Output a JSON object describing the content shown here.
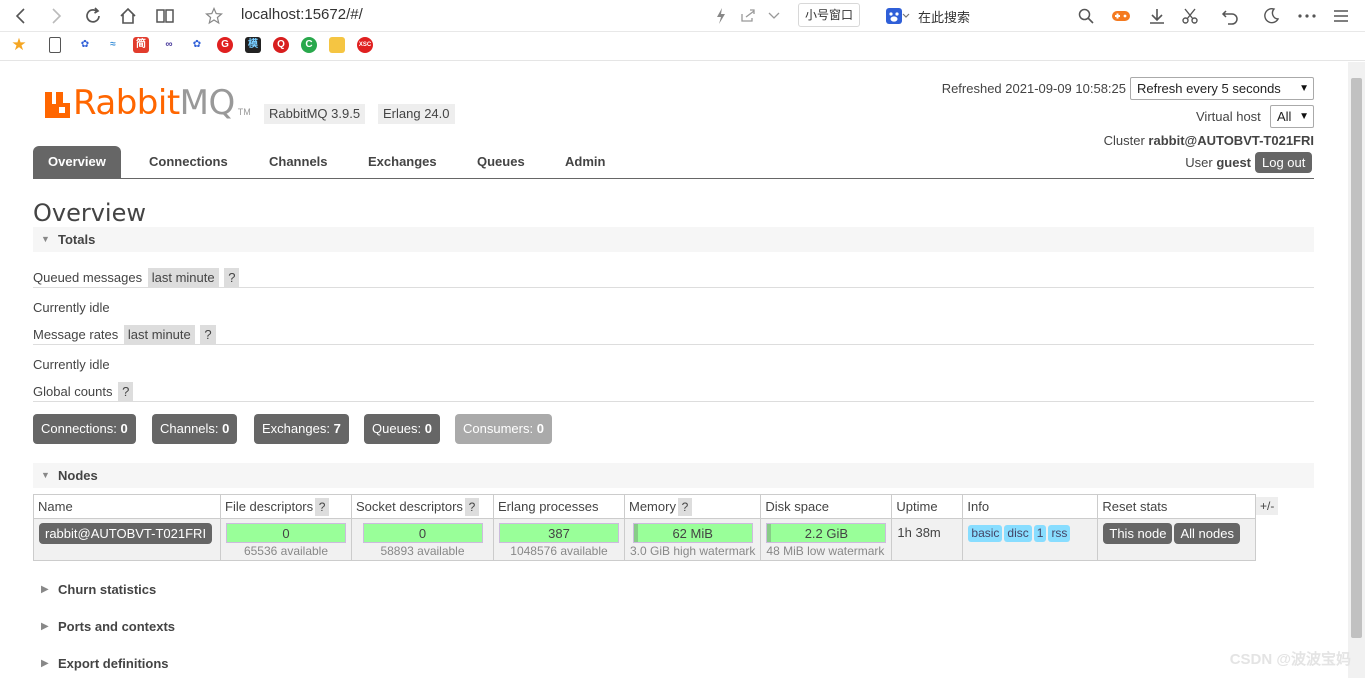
{
  "browser": {
    "url": "localhost:15672/#/",
    "small_window_button": "小号窗口",
    "search_label": "在此搜索"
  },
  "header": {
    "logo_text_a": "Rabbit",
    "logo_text_b": "MQ",
    "logo_tm": "TM",
    "rabbit_version": "RabbitMQ 3.9.5",
    "erlang_version": "Erlang 24.0",
    "refreshed": "Refreshed 2021-09-09 10:58:25",
    "refresh_select": "Refresh every 5 seconds",
    "vhost_label": "Virtual host",
    "vhost_value": "All",
    "cluster_label": "Cluster",
    "cluster_value": "rabbit@AUTOBVT-T021FRI",
    "user_label": "User",
    "user_value": "guest",
    "logout": "Log out"
  },
  "tabs": [
    "Overview",
    "Connections",
    "Channels",
    "Exchanges",
    "Queues",
    "Admin"
  ],
  "page_title": "Overview",
  "totals": {
    "title": "Totals",
    "queued_label": "Queued messages",
    "queued_chip": "last minute",
    "qm": "?",
    "queued_status": "Currently idle",
    "rates_label": "Message rates",
    "rates_chip": "last minute",
    "rates_status": "Currently idle",
    "global_label": "Global counts"
  },
  "counts": [
    {
      "label": "Connections:",
      "value": "0"
    },
    {
      "label": "Channels:",
      "value": "0"
    },
    {
      "label": "Exchanges:",
      "value": "7"
    },
    {
      "label": "Queues:",
      "value": "0"
    },
    {
      "label": "Consumers:",
      "value": "0"
    }
  ],
  "nodes": {
    "title": "Nodes",
    "plusminus": "+/-",
    "headers": [
      "Name",
      "File descriptors",
      "Socket descriptors",
      "Erlang processes",
      "Memory",
      "Disk space",
      "Uptime",
      "Info",
      "Reset stats"
    ],
    "row": {
      "name": "rabbit@AUTOBVT-T021FRI",
      "fd": "0",
      "fd_sub": "65536 available",
      "sd": "0",
      "sd_sub": "58893 available",
      "ep": "387",
      "ep_sub": "1048576 available",
      "mem": "62 MiB",
      "mem_sub": "3.0 GiB high watermark",
      "disk": "2.2 GiB",
      "disk_sub": "48 MiB low watermark",
      "uptime": "1h 38m",
      "info": [
        "basic",
        "disc",
        "1",
        "rss"
      ],
      "reset_this": "This node",
      "reset_all": "All nodes"
    }
  },
  "sections": [
    "Churn statistics",
    "Ports and contexts",
    "Export definitions"
  ],
  "watermark": "CSDN @波波宝妈"
}
